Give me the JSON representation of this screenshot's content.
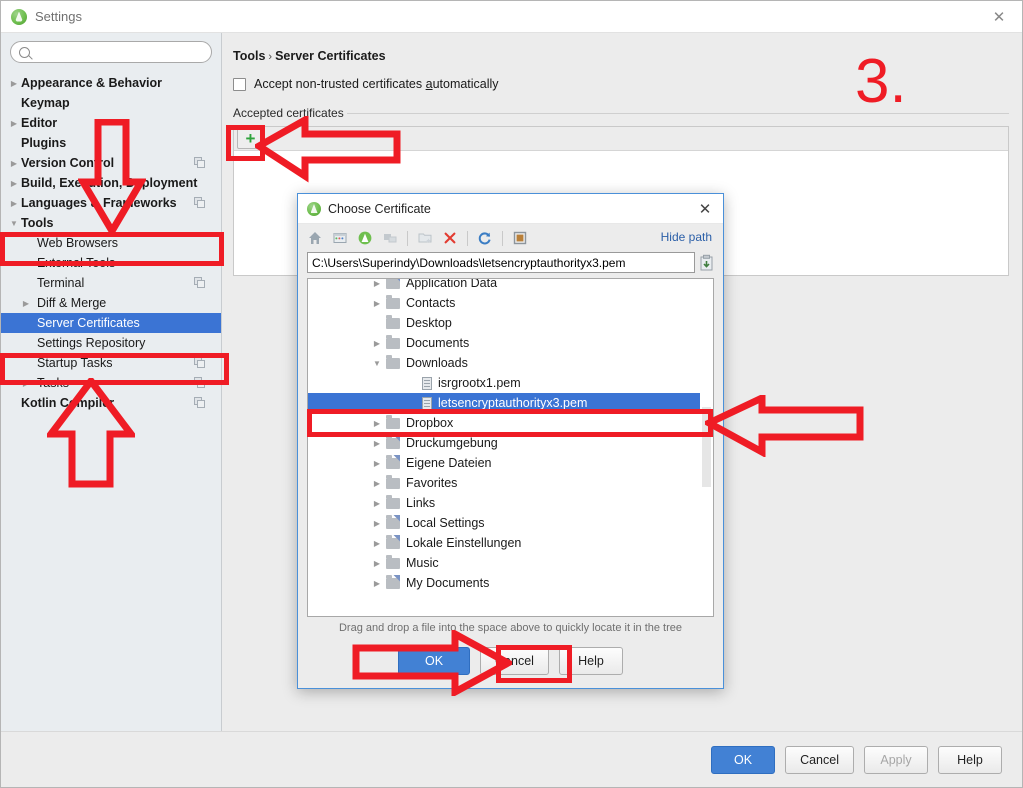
{
  "window": {
    "title": "Settings",
    "icon": "android-studio-icon",
    "close_label": "✕"
  },
  "search": {
    "value": "",
    "placeholder": "",
    "icon": "search-icon"
  },
  "sidebar": {
    "items": [
      {
        "label": "Appearance & Behavior",
        "twisty": "▶",
        "bold": true,
        "indent": false,
        "copy": false,
        "selected": false
      },
      {
        "label": "Keymap",
        "twisty": "",
        "bold": true,
        "indent": false,
        "copy": false,
        "selected": false
      },
      {
        "label": "Editor",
        "twisty": "▶",
        "bold": true,
        "indent": false,
        "copy": false,
        "selected": false
      },
      {
        "label": "Plugins",
        "twisty": "",
        "bold": true,
        "indent": false,
        "copy": false,
        "selected": false
      },
      {
        "label": "Version Control",
        "twisty": "▶",
        "bold": true,
        "indent": false,
        "copy": true,
        "selected": false
      },
      {
        "label": "Build, Execution, Deployment",
        "twisty": "▶",
        "bold": true,
        "indent": false,
        "copy": false,
        "selected": false
      },
      {
        "label": "Languages & Frameworks",
        "twisty": "▶",
        "bold": true,
        "indent": false,
        "copy": true,
        "selected": false
      },
      {
        "label": "Tools",
        "twisty": "▼",
        "bold": true,
        "indent": false,
        "copy": false,
        "selected": false
      },
      {
        "label": "Web Browsers",
        "twisty": "",
        "bold": false,
        "indent": true,
        "copy": false,
        "selected": false
      },
      {
        "label": "External Tools",
        "twisty": "",
        "bold": false,
        "indent": true,
        "copy": false,
        "selected": false
      },
      {
        "label": "Terminal",
        "twisty": "",
        "bold": false,
        "indent": true,
        "copy": true,
        "selected": false
      },
      {
        "label": "Diff & Merge",
        "twisty": "▶",
        "bold": false,
        "indent": true,
        "copy": false,
        "selected": false
      },
      {
        "label": "Server Certificates",
        "twisty": "",
        "bold": false,
        "indent": true,
        "copy": false,
        "selected": true
      },
      {
        "label": "Settings Repository",
        "twisty": "",
        "bold": false,
        "indent": true,
        "copy": false,
        "selected": false
      },
      {
        "label": "Startup Tasks",
        "twisty": "",
        "bold": false,
        "indent": true,
        "copy": true,
        "selected": false
      },
      {
        "label": "Tasks",
        "twisty": "▶",
        "bold": false,
        "indent": true,
        "copy": true,
        "selected": false
      },
      {
        "label": "Kotlin Compiler",
        "twisty": "",
        "bold": true,
        "indent": false,
        "copy": true,
        "selected": false
      }
    ]
  },
  "main": {
    "breadcrumb": {
      "parent": "Tools",
      "separator": "›",
      "current": "Server Certificates"
    },
    "accept_checkbox": {
      "label_pre": "Accept non-trusted certificates ",
      "label_underlined": "a",
      "label_post": "utomatically",
      "checked": false
    },
    "group_title": "Accepted certificates",
    "add_button": {
      "label": "+",
      "icon": "plus-icon"
    }
  },
  "footer": {
    "ok": "OK",
    "cancel": "Cancel",
    "apply": "Apply",
    "help": "Help",
    "apply_disabled": true
  },
  "dialog": {
    "title": "Choose Certificate",
    "icon": "android-studio-icon",
    "close_label": "✕",
    "hide_path": "Hide path",
    "path_value": "C:\\Users\\Superindy\\Downloads\\letsencryptauthorityx3.pem",
    "toolbar_icons": [
      "home-icon",
      "desktop-icon",
      "project-icon",
      "module-icon",
      "separator",
      "new-folder-icon",
      "delete-icon",
      "separator",
      "refresh-icon",
      "separator",
      "show-hidden-files-icon"
    ],
    "tree": [
      {
        "label": "Application Data",
        "type": "folder-link",
        "twisty": "▶",
        "indent": 1,
        "selected": false
      },
      {
        "label": "Contacts",
        "type": "folder",
        "twisty": "▶",
        "indent": 1,
        "selected": false
      },
      {
        "label": "Desktop",
        "type": "folder",
        "twisty": "",
        "indent": 1,
        "selected": false
      },
      {
        "label": "Documents",
        "type": "folder",
        "twisty": "▶",
        "indent": 1,
        "selected": false
      },
      {
        "label": "Downloads",
        "type": "folder",
        "twisty": "▼",
        "indent": 1,
        "selected": false
      },
      {
        "label": "isrgrootx1.pem",
        "type": "file",
        "twisty": "",
        "indent": 2,
        "selected": false
      },
      {
        "label": "letsencryptauthorityx3.pem",
        "type": "file",
        "twisty": "",
        "indent": 2,
        "selected": true
      },
      {
        "label": "Dropbox",
        "type": "folder",
        "twisty": "▶",
        "indent": 1,
        "selected": false
      },
      {
        "label": "Druckumgebung",
        "type": "folder-link",
        "twisty": "▶",
        "indent": 1,
        "selected": false
      },
      {
        "label": "Eigene Dateien",
        "type": "folder-link",
        "twisty": "▶",
        "indent": 1,
        "selected": false
      },
      {
        "label": "Favorites",
        "type": "folder",
        "twisty": "▶",
        "indent": 1,
        "selected": false
      },
      {
        "label": "Links",
        "type": "folder",
        "twisty": "▶",
        "indent": 1,
        "selected": false
      },
      {
        "label": "Local Settings",
        "type": "folder-link",
        "twisty": "▶",
        "indent": 1,
        "selected": false
      },
      {
        "label": "Lokale Einstellungen",
        "type": "folder-link",
        "twisty": "▶",
        "indent": 1,
        "selected": false
      },
      {
        "label": "Music",
        "type": "folder",
        "twisty": "▶",
        "indent": 1,
        "selected": false
      },
      {
        "label": "My Documents",
        "type": "folder-link",
        "twisty": "▶",
        "indent": 1,
        "selected": false
      }
    ],
    "hint": "Drag and drop a file into the space above to quickly locate it in the tree",
    "buttons": {
      "ok": "OK",
      "cancel": "Cancel",
      "help": "Help"
    }
  },
  "annotations": {
    "step_number": "3.",
    "color": "#EF1C25"
  }
}
